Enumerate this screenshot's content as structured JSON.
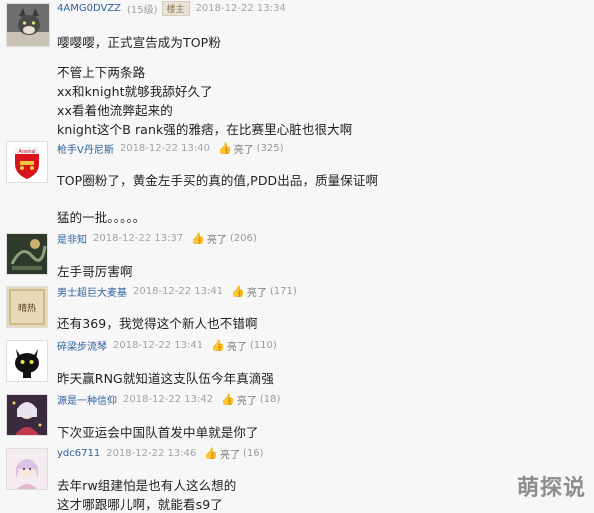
{
  "posts": [
    {
      "username": "4AMG0DVZZ",
      "level": "(15级)",
      "badge": "楼主",
      "time": "2018-12-22 13:34",
      "lines": [
        "嘤嘤嘤，正式宣告成为TOP粉",
        "不管上下两条路",
        "xx和knight就够我舔好久了",
        "xx看着他流弊起来的",
        "knight这个B rank强的雅痞，在比赛里心脏也很大啊"
      ]
    },
    {
      "username": "枪手V丹尼斯",
      "time": "2018-12-22 13:40",
      "like_label": "亮了",
      "likes": "(325)",
      "lines": [
        "TOP圈粉了，黄金左手买的真的值,PDD出品，质量保证啊",
        "猛的一批。。。。。"
      ]
    },
    {
      "username": "是非知",
      "time": "2018-12-22 13:37",
      "like_label": "亮了",
      "likes": "(206)",
      "lines": [
        "左手哥厉害啊"
      ]
    },
    {
      "username": "男士超巨大麦基",
      "time": "2018-12-22 13:41",
      "like_label": "亮了",
      "likes": "(171)",
      "lines": [
        "还有369，我觉得这个新人也不错啊"
      ]
    },
    {
      "username": "碎梁步流琴",
      "time": "2018-12-22 13:41",
      "like_label": "亮了",
      "likes": "(110)",
      "lines": [
        "昨天赢RNG就知道这支队伍今年真滴强"
      ]
    },
    {
      "username": "源是一种信仰",
      "time": "2018-12-22 13:42",
      "like_label": "亮了",
      "likes": "(18)",
      "lines": [
        "下次亚运会中国队首发中单就是你了"
      ]
    },
    {
      "username": "ydc6711",
      "time": "2018-12-22 13:46",
      "like_label": "亮了",
      "likes": "(16)",
      "lines": [
        "去年rw组建怕是也有人这么想的",
        "这才哪跟哪儿啊，就能看s9了"
      ]
    }
  ],
  "avatars": {
    "p1": "cat-avatar",
    "p2": "arsenal-crest",
    "arsenal_text": "Arsenal",
    "p4_text": "晴热",
    "p3": "dark-art",
    "p5": "black-cat",
    "p6": "anime-dark",
    "p7": "anime-girl"
  },
  "watermark": "萌探说"
}
